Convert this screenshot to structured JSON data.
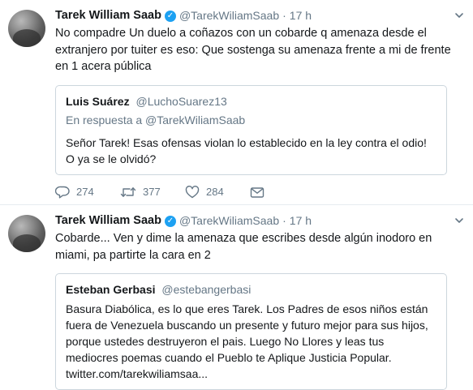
{
  "tweets": [
    {
      "author": {
        "name": "Tarek William Saab",
        "handle": "@TarekWiliamSaab"
      },
      "time": "17 h",
      "text": "No compadre Un duelo a coñazos con un cobarde q amenaza desde el extranjero por tuiter es eso: Que sostenga su amenaza frente a mi de frente en 1 acera pública",
      "quote": {
        "name": "Luis Suárez",
        "handle": "@LuchoSuarez13",
        "reply_to": "En respuesta a @TarekWiliamSaab",
        "text": "Señor Tarek! Esas ofensas violan lo establecido en la ley contra el odio! O ya se le olvidó?"
      },
      "actions": {
        "replies": "274",
        "retweets": "377",
        "likes": "284"
      }
    },
    {
      "author": {
        "name": "Tarek William Saab",
        "handle": "@TarekWiliamSaab"
      },
      "time": "17 h",
      "text": "Cobarde... Ven y dime la amenaza que escribes desde algún inodoro en miami, pa partirte la cara en 2",
      "quote": {
        "name": "Esteban Gerbasi",
        "handle": "@estebangerbasi",
        "text": "Basura Diabólica, es lo que eres Tarek. Los Padres de esos niños están fuera de Venezuela buscando un presente y futuro mejor para sus hijos, porque ustedes destruyeron el pais. Luego No Llores y leas tus mediocres poemas cuando el Pueblo te Aplique Justicia Popular. twitter.com/tarekwiliamsaa..."
      }
    }
  ],
  "icons": {
    "verified": "✓",
    "reply": "reply-icon",
    "retweet": "retweet-icon",
    "like": "heart-icon",
    "dm": "envelope-icon"
  },
  "colors": {
    "accent": "#1da1f2",
    "secondary_text": "#657786",
    "border": "#ccd6dd"
  }
}
